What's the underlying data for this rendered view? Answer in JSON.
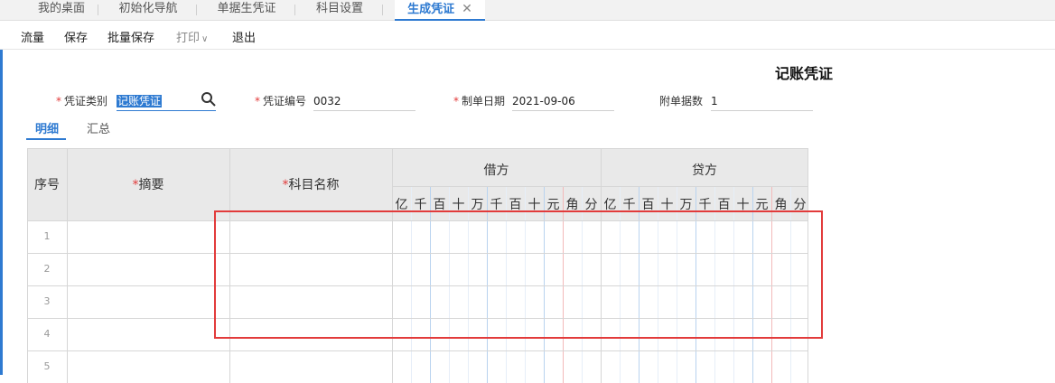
{
  "tabs": [
    {
      "label": "我的桌面"
    },
    {
      "label": "初始化导航"
    },
    {
      "label": "单据生凭证"
    },
    {
      "label": "科目设置"
    },
    {
      "label": "生成凭证"
    }
  ],
  "toolbar": {
    "flow": "流量",
    "save": "保存",
    "batch_save": "批量保存",
    "print": "打印",
    "exit": "退出"
  },
  "voucher": {
    "title": "记账凭证",
    "category_label": "凭证类别",
    "category_value": "记账凭证",
    "number_label": "凭证编号",
    "number_value": "0032",
    "date_label": "制单日期",
    "date_value": "2021-09-06",
    "attachments_label": "附单据数",
    "attachments_value": "1"
  },
  "subtabs": [
    {
      "label": "明细"
    },
    {
      "label": "汇总"
    }
  ],
  "table": {
    "headers": {
      "seq": "序号",
      "summary": "摘要",
      "account": "科目名称",
      "debit": "借方",
      "credit": "贷方"
    },
    "digits": [
      "亿",
      "千",
      "百",
      "十",
      "万",
      "千",
      "百",
      "十",
      "元",
      "角",
      "分"
    ],
    "rows": [
      "1",
      "2",
      "3",
      "4",
      "5"
    ]
  },
  "icons": {
    "search": "search-icon",
    "close": "close-icon",
    "dropdown": "chevron-down-icon"
  },
  "colors": {
    "accent": "#2e7ad1",
    "required": "#e23b3b",
    "highlight": "#e23b3b"
  }
}
